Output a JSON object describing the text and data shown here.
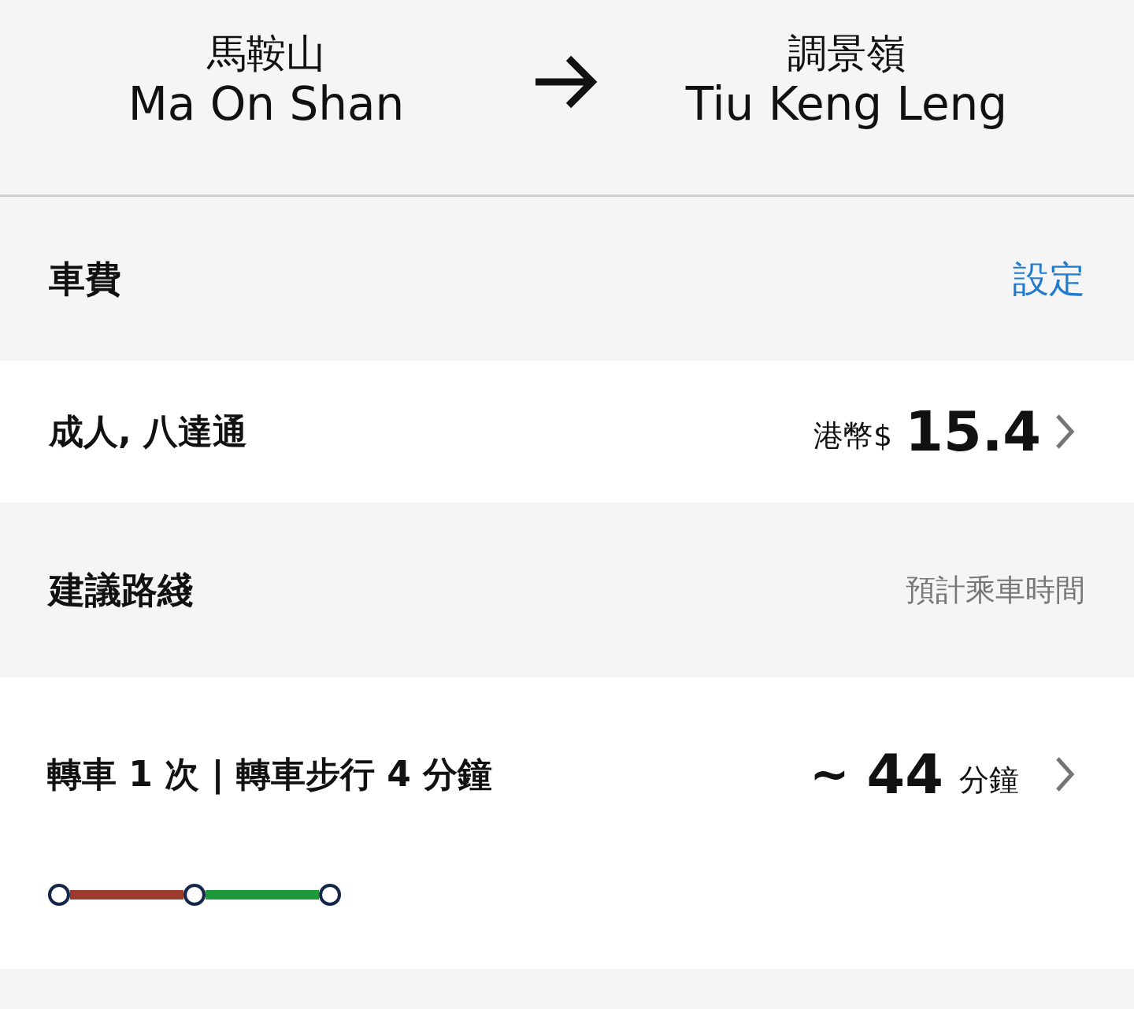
{
  "header": {
    "origin": {
      "name_zh": "馬鞍山",
      "name_en": "Ma On Shan"
    },
    "destination": {
      "name_zh": "調景嶺",
      "name_en": "Tiu Keng Leng"
    }
  },
  "fare": {
    "title": "車費",
    "action": "設定",
    "ticket": "成人, 八達通",
    "currency": "港幣$",
    "amount": "15.4"
  },
  "routes": {
    "title": "建議路綫",
    "time_label": "預計乘車時間",
    "items": [
      {
        "summary": "轉車 1 次 | 轉車步行 4 分鐘",
        "approx": "~",
        "duration": "44",
        "unit": "分鐘",
        "segments": [
          {
            "color": "#9b3b2b"
          },
          {
            "color": "#1f9a3a"
          }
        ]
      }
    ]
  }
}
